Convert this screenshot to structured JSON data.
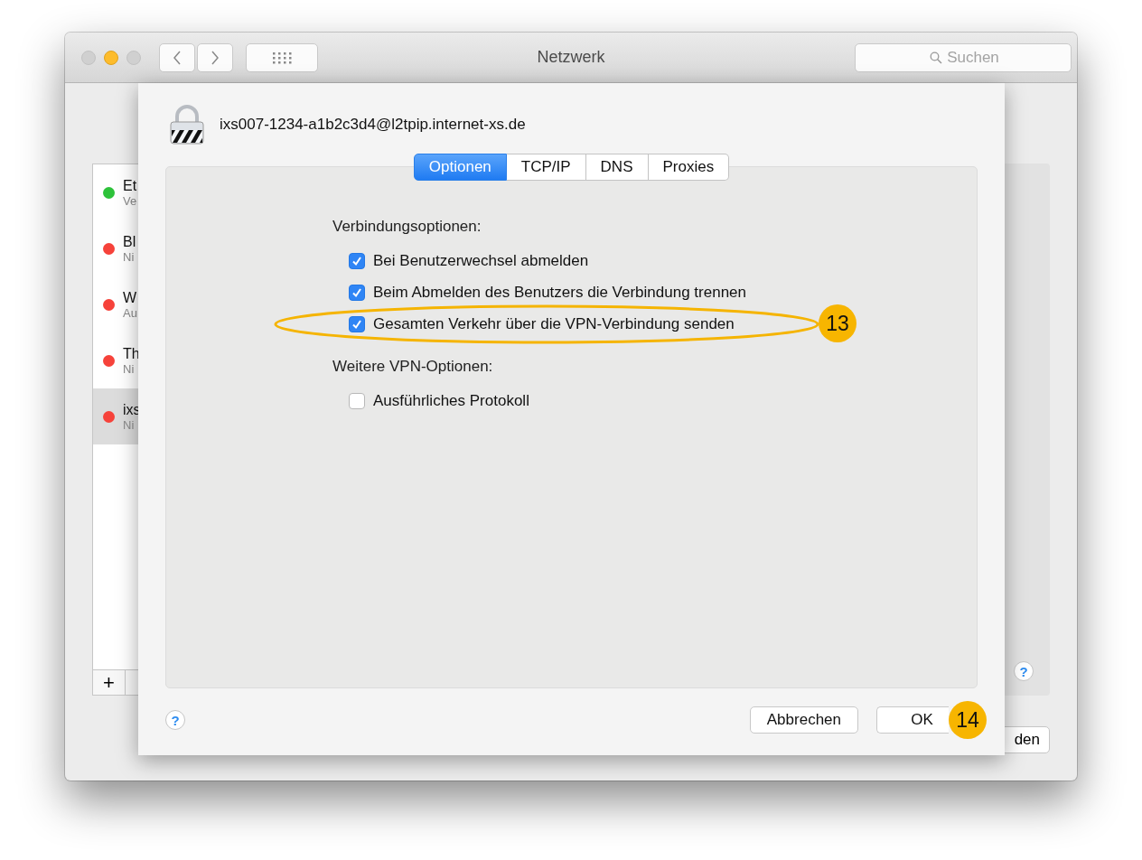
{
  "window": {
    "title": "Netzwerk",
    "search": {
      "placeholder": "Suchen"
    }
  },
  "sidebar": {
    "items": [
      {
        "name": "Et",
        "status": "Ve",
        "color": "#2dc23a",
        "selected": false
      },
      {
        "name": "Bl",
        "status": "Ni",
        "color": "#f6423a",
        "selected": false
      },
      {
        "name": "W",
        "status": "Au",
        "color": "#f6423a",
        "selected": false
      },
      {
        "name": "Th",
        "status": "Ni",
        "color": "#f6423a",
        "selected": false
      },
      {
        "name": "ixs",
        "status": "Ni",
        "color": "#f6423a",
        "selected": true
      }
    ],
    "add_button": "+"
  },
  "background_button": "den",
  "background_help": "?",
  "sheet": {
    "title": "ixs007-1234-a1b2c3d4@l2tpip.internet-xs.de",
    "tabs": [
      {
        "label": "Optionen",
        "selected": true
      },
      {
        "label": "TCP/IP",
        "selected": false
      },
      {
        "label": "DNS",
        "selected": false
      },
      {
        "label": "Proxies",
        "selected": false
      }
    ],
    "sections": [
      {
        "heading": "Verbindungsoptionen:",
        "options": [
          {
            "label": "Bei Benutzerwechsel abmelden",
            "checked": true
          },
          {
            "label": "Beim Abmelden des Benutzers die Verbindung trennen",
            "checked": true
          },
          {
            "label": "Gesamten Verkehr über die VPN-Verbindung senden",
            "checked": true,
            "callout": "13"
          }
        ]
      },
      {
        "heading": "Weitere VPN-Optionen:",
        "options": [
          {
            "label": "Ausführliches Protokoll",
            "checked": false
          }
        ]
      }
    ],
    "help": "?",
    "buttons": [
      {
        "label": "Abbrechen"
      },
      {
        "label": "OK",
        "callout": "14"
      }
    ]
  }
}
